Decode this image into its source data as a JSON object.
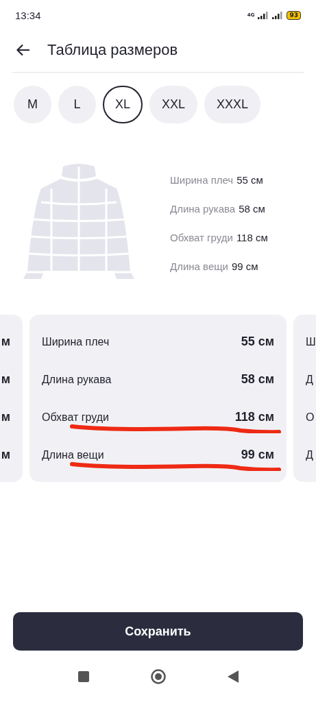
{
  "status_bar": {
    "time": "13:34",
    "network": "4G",
    "battery": "93"
  },
  "header": {
    "title": "Таблица размеров"
  },
  "sizes": [
    {
      "label": "M",
      "selected": false
    },
    {
      "label": "L",
      "selected": false
    },
    {
      "label": "XL",
      "selected": true
    },
    {
      "label": "XXL",
      "selected": false
    },
    {
      "label": "XXXL",
      "selected": false
    }
  ],
  "summary": [
    {
      "label": "Ширина плеч",
      "value": "55 см"
    },
    {
      "label": "Длина рукава",
      "value": "58 см"
    },
    {
      "label": "Обхват груди",
      "value": "118 см"
    },
    {
      "label": "Длина вещи",
      "value": "99 см"
    }
  ],
  "size_cards": [
    {
      "kind": "clipped_left",
      "texts": [
        "м",
        "м",
        "м",
        "м"
      ]
    },
    {
      "kind": "full",
      "rows": [
        {
          "label": "Ширина плеч",
          "value": "55 см",
          "underlined": false
        },
        {
          "label": "Длина рукава",
          "value": "58 см",
          "underlined": false
        },
        {
          "label": "Обхват груди",
          "value": "118 см",
          "underlined": true
        },
        {
          "label": "Длина вещи",
          "value": "99 см",
          "underlined": true
        }
      ]
    },
    {
      "kind": "clipped_right",
      "texts": [
        "Ш",
        "Д",
        "О",
        "Д"
      ]
    }
  ],
  "save_button": {
    "label": "Сохранить"
  }
}
